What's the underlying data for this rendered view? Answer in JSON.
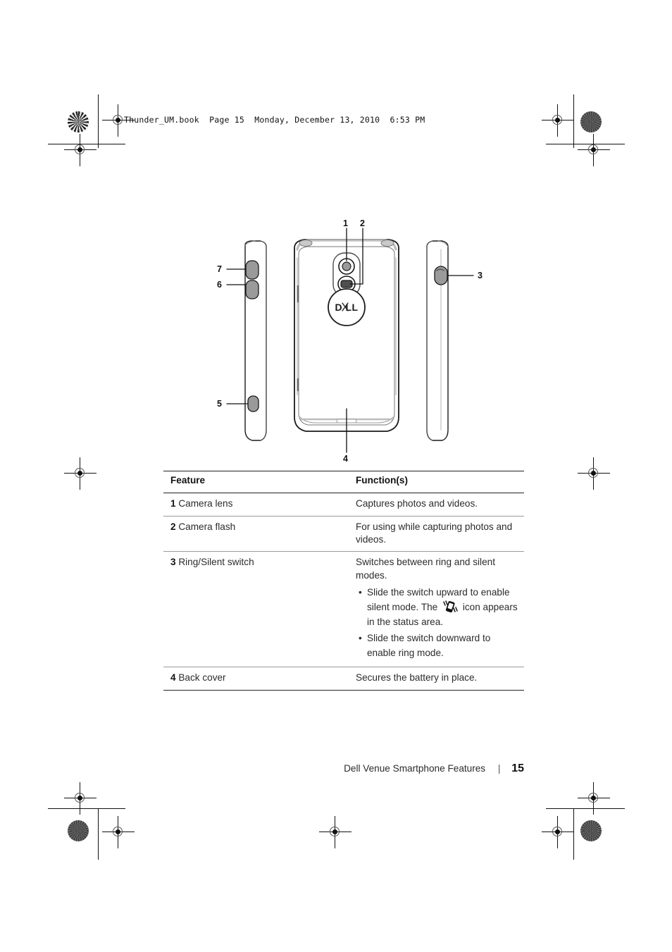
{
  "document": {
    "slug": "Thunder_UM.book  Page 15  Monday, December 13, 2010  6:53 PM"
  },
  "figure": {
    "alt_name": "dell-venue-smartphone-back-and-side-views",
    "callouts": [
      {
        "id": "7",
        "label": "7"
      },
      {
        "id": "6",
        "label": "6"
      },
      {
        "id": "5",
        "label": "5"
      },
      {
        "id": "1",
        "label": "1"
      },
      {
        "id": "2",
        "label": "2"
      },
      {
        "id": "3",
        "label": "3"
      },
      {
        "id": "4",
        "label": "4"
      }
    ],
    "logo_text": "DELL"
  },
  "table": {
    "headers": {
      "feature": "Feature",
      "function": "Function(s)"
    },
    "rows": [
      {
        "num": "1",
        "feature": "Camera lens",
        "function": "Captures photos and videos."
      },
      {
        "num": "2",
        "feature": "Camera flash",
        "function": "For using while capturing photos and videos."
      },
      {
        "num": "3",
        "feature": "Ring/Silent switch",
        "function": "Switches between ring and silent modes.",
        "bullets": [
          {
            "part1": "Slide the switch upward to enable",
            "part2": "silent mode. The",
            "icon": "vibrate-phone-icon",
            "part3": "icon appears",
            "part4": "in the status area."
          },
          {
            "part1": "Slide the switch downward to",
            "part2": "enable ring mode."
          }
        ]
      },
      {
        "num": "4",
        "feature": "Back cover",
        "function": "Secures the battery in place."
      }
    ]
  },
  "footer": {
    "chapter": "Dell Venue Smartphone Features",
    "separator": "|",
    "page_number": "15"
  },
  "colors": {
    "text": "#2b2b2b",
    "heading": "#111111",
    "rule_light": "#9a9a9a",
    "rule_dark": "#222222"
  }
}
